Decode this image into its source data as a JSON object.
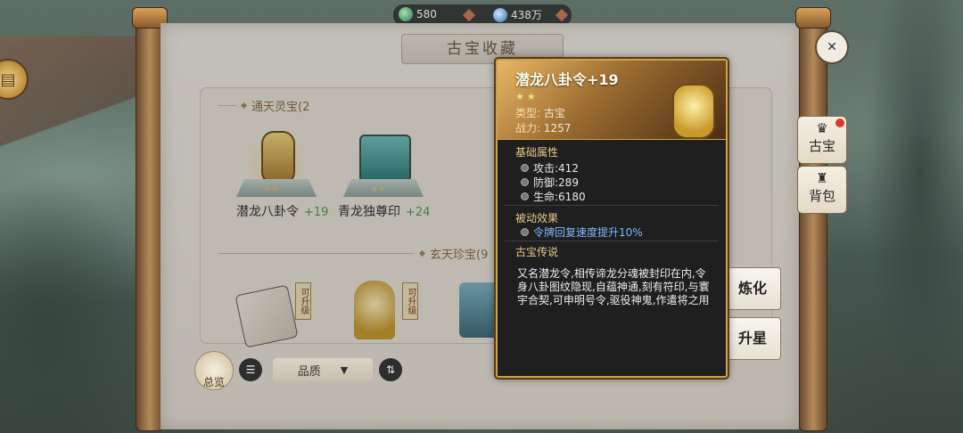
{
  "currency": {
    "jade": "580",
    "water": "438万"
  },
  "scroll": {
    "title": "古宝收藏"
  },
  "sections": [
    {
      "label": "通天灵宝(2"
    },
    {
      "label": "玄天珍宝(9"
    }
  ],
  "items": [
    {
      "name": "潜龙八卦令",
      "level": "+19",
      "stars": "★★"
    },
    {
      "name": "青龙独尊印",
      "level": "+24",
      "stars": "★★"
    }
  ],
  "lower_items": [
    {
      "tag": "可升级"
    },
    {
      "tag": "可升级"
    }
  ],
  "controls": {
    "overview": "总览",
    "list": "☰",
    "quality": "品质",
    "sort": "⇅"
  },
  "side_tabs": {
    "treasure": "古宝",
    "bag": "背包"
  },
  "actions": {
    "refine": "炼化",
    "upgrade_star": "升星"
  },
  "tooltip": {
    "name": "潜龙八卦令+19",
    "stars": "★★",
    "type_label": "类型:",
    "type_value": "古宝",
    "power_label": "战力:",
    "power_value": "1257",
    "base_title": "基础属性",
    "attack": "攻击:412",
    "defense": "防御:289",
    "life": "生命:6180",
    "passive_title": "被动效果",
    "passive_text": "令牌回复速度提升10%",
    "lore_title": "古宝传说",
    "lore_text": "又名潜龙令,相传谛龙分魂被封印在内,令身八卦图纹隐现,自蕴神通,刻有符印,与寰宇合契,可申明号令,驱役神鬼,作遣将之用"
  }
}
